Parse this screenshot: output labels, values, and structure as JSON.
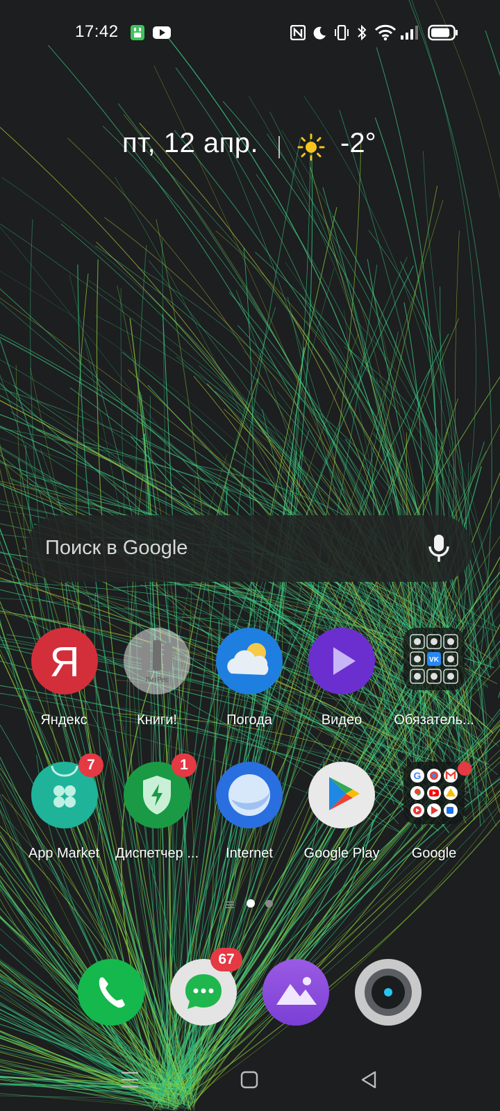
{
  "status_bar": {
    "time": "17:42",
    "left_icons": [
      "sim-manager-icon",
      "youtube-icon"
    ],
    "right_icons": [
      "nfc-icon",
      "do-not-disturb-icon",
      "vibrate-icon",
      "bluetooth-icon",
      "wifi-icon",
      "signal-icon",
      "battery-icon"
    ]
  },
  "widget": {
    "date": "пт, 12 апр.",
    "weather_icon": "sun-icon",
    "temperature": "-2°"
  },
  "search": {
    "placeholder": "Поиск в Google",
    "mic_icon": "mic-icon"
  },
  "apps": {
    "row1": [
      {
        "label": "Яндекс",
        "icon": "yandex-icon",
        "glyph": "Я"
      },
      {
        "label": "Книги!",
        "icon": "litres-icon",
        "subtext": "ЛитРес"
      },
      {
        "label": "Погода",
        "icon": "weather-icon"
      },
      {
        "label": "Видео",
        "icon": "video-icon"
      },
      {
        "label": "Обязатель...",
        "icon": "folder-icon",
        "folder_badge": "VK"
      }
    ],
    "row2": [
      {
        "label": "App Market",
        "icon": "app-market-icon",
        "badge": "7"
      },
      {
        "label": "Диспетчер ...",
        "icon": "phone-manager-icon",
        "badge": "1"
      },
      {
        "label": "Internet",
        "icon": "browser-icon"
      },
      {
        "label": "Google Play",
        "icon": "google-play-icon"
      },
      {
        "label": "Google",
        "icon": "google-folder-icon",
        "folder_letter": "G"
      }
    ]
  },
  "page_indicator": {
    "pages": 2,
    "current": 1
  },
  "dock": [
    {
      "name": "phone",
      "icon": "phone-icon"
    },
    {
      "name": "messages",
      "icon": "messages-icon",
      "badge": "67"
    },
    {
      "name": "gallery",
      "icon": "gallery-icon"
    },
    {
      "name": "camera",
      "icon": "camera-icon"
    }
  ],
  "nav_bar": [
    "menu-icon",
    "home-icon",
    "back-icon"
  ],
  "colors": {
    "background": "#1c1e1f",
    "badge": "#e53944",
    "wallpaper_strands": [
      "#2fb87a",
      "#3fcf86",
      "#8fcf3a",
      "#b9c93a"
    ]
  }
}
